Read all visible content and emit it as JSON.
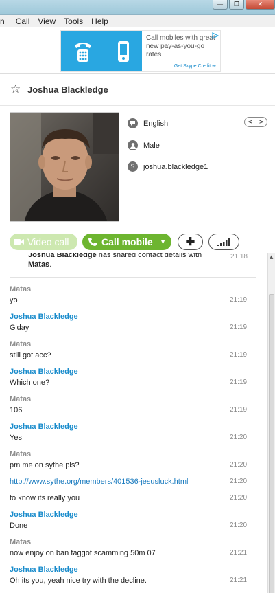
{
  "window": {
    "minimize": "—",
    "maximize": "❐",
    "close": "✕"
  },
  "menu": [
    "n",
    "Call",
    "View",
    "Tools",
    "Help"
  ],
  "ad": {
    "text": "Call mobiles with great new pay-as-you-go rates",
    "link": "Get Skype Credit ➔"
  },
  "profile": {
    "name": "Joshua Blackledge",
    "language": "English",
    "gender": "Male",
    "skype_name": "joshua.blackledge1"
  },
  "actions": {
    "video_call": "Video call",
    "call_mobile": "Call mobile"
  },
  "shared": {
    "line1_name": "Joshua Blackledge",
    "line1_rest": " has shared contact details with",
    "line2_name": "Matas",
    "line2_rest": ".",
    "time": "21:18"
  },
  "messages": [
    {
      "sender": "Matas",
      "text": "yo",
      "time": "21:19",
      "is_link": false,
      "from": "matas"
    },
    {
      "sender": "Joshua Blackledge",
      "text": "G'day",
      "time": "21:19",
      "is_link": false,
      "from": "joshua"
    },
    {
      "sender": "Matas",
      "text": "still got acc?",
      "time": "21:19",
      "is_link": false,
      "from": "matas"
    },
    {
      "sender": "Joshua Blackledge",
      "text": "Which one?",
      "time": "21:19",
      "is_link": false,
      "from": "joshua"
    },
    {
      "sender": "Matas",
      "text": "106",
      "time": "21:19",
      "is_link": false,
      "from": "matas"
    },
    {
      "sender": "Joshua Blackledge",
      "text": "Yes",
      "time": "21:20",
      "is_link": false,
      "from": "joshua"
    },
    {
      "sender": "Matas",
      "text": "pm me on sythe pls?",
      "time": "21:20",
      "is_link": false,
      "from": "matas"
    },
    {
      "sender": "",
      "text": "http://www.sythe.org/members/401536-jesusluck.html",
      "time": "21:20",
      "is_link": true,
      "from": "matas"
    },
    {
      "sender": "",
      "text": "to know its really you",
      "time": "21:20",
      "is_link": false,
      "from": "matas"
    },
    {
      "sender": "Joshua Blackledge",
      "text": "Done",
      "time": "21:20",
      "is_link": false,
      "from": "joshua"
    },
    {
      "sender": "Matas",
      "text": "now enjoy on ban faggot scamming 50m 07",
      "time": "21:21",
      "is_link": false,
      "from": "matas"
    },
    {
      "sender": "Joshua Blackledge",
      "text": "Oh its you, yeah nice try with the decline.",
      "time": "21:21",
      "is_link": false,
      "from": "joshua"
    }
  ]
}
